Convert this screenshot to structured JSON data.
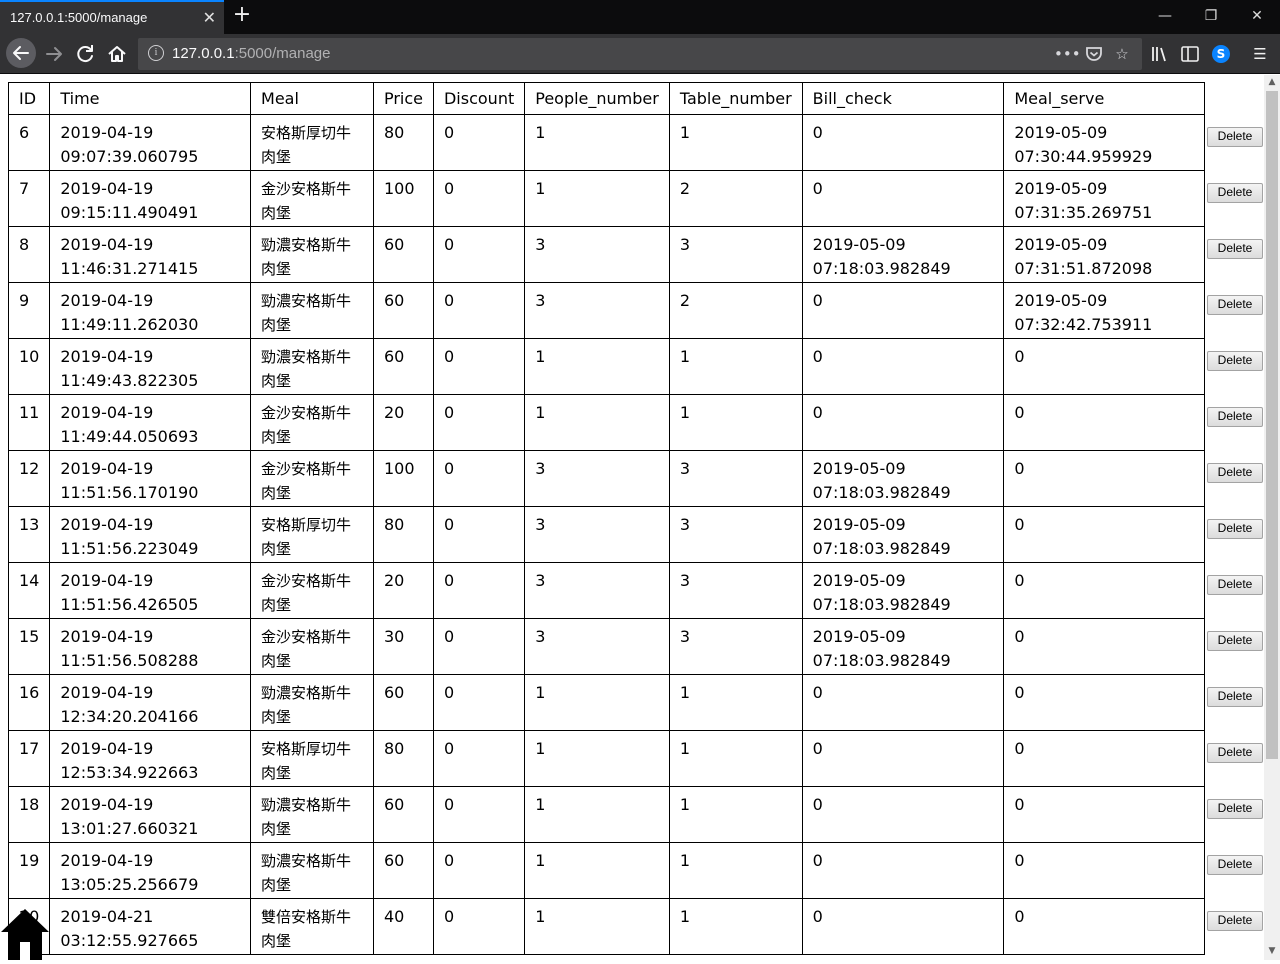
{
  "browser": {
    "tab_title": "127.0.0.1:5000/manage",
    "tab_close": "✕",
    "new_tab": "+",
    "url_host": "127.0.0.1",
    "url_rest": ":5000/manage",
    "minimize": "—",
    "restore": "❐",
    "close": "✕"
  },
  "table": {
    "headers": [
      "ID",
      "Time",
      "Meal",
      "Price",
      "Discount",
      "People_number",
      "Table_number",
      "Bill_check",
      "Meal_serve"
    ],
    "delete_label": "Delete",
    "rows": [
      {
        "id": "6",
        "time1": "2019-04-19",
        "time2": "09:07:39.060795",
        "meal": "安格斯厚切牛肉堡",
        "price": "80",
        "discount": "0",
        "people": "1",
        "table": "1",
        "bill1": "0",
        "bill2": "",
        "serve1": "2019-05-09",
        "serve2": "07:30:44.959929"
      },
      {
        "id": "7",
        "time1": "2019-04-19",
        "time2": "09:15:11.490491",
        "meal": "金沙安格斯牛肉堡",
        "price": "100",
        "discount": "0",
        "people": "1",
        "table": "2",
        "bill1": "0",
        "bill2": "",
        "serve1": "2019-05-09",
        "serve2": "07:31:35.269751"
      },
      {
        "id": "8",
        "time1": "2019-04-19",
        "time2": "11:46:31.271415",
        "meal": "勁濃安格斯牛肉堡",
        "price": "60",
        "discount": "0",
        "people": "3",
        "table": "3",
        "bill1": "2019-05-09",
        "bill2": "07:18:03.982849",
        "serve1": "2019-05-09",
        "serve2": "07:31:51.872098"
      },
      {
        "id": "9",
        "time1": "2019-04-19",
        "time2": "11:49:11.262030",
        "meal": "勁濃安格斯牛肉堡",
        "price": "60",
        "discount": "0",
        "people": "3",
        "table": "2",
        "bill1": "0",
        "bill2": "",
        "serve1": "2019-05-09",
        "serve2": "07:32:42.753911"
      },
      {
        "id": "10",
        "time1": "2019-04-19",
        "time2": "11:49:43.822305",
        "meal": "勁濃安格斯牛肉堡",
        "price": "60",
        "discount": "0",
        "people": "1",
        "table": "1",
        "bill1": "0",
        "bill2": "",
        "serve1": "0",
        "serve2": ""
      },
      {
        "id": "11",
        "time1": "2019-04-19",
        "time2": "11:49:44.050693",
        "meal": "金沙安格斯牛肉堡",
        "price": "20",
        "discount": "0",
        "people": "1",
        "table": "1",
        "bill1": "0",
        "bill2": "",
        "serve1": "0",
        "serve2": ""
      },
      {
        "id": "12",
        "time1": "2019-04-19",
        "time2": "11:51:56.170190",
        "meal": "金沙安格斯牛肉堡",
        "price": "100",
        "discount": "0",
        "people": "3",
        "table": "3",
        "bill1": "2019-05-09",
        "bill2": "07:18:03.982849",
        "serve1": "0",
        "serve2": ""
      },
      {
        "id": "13",
        "time1": "2019-04-19",
        "time2": "11:51:56.223049",
        "meal": "安格斯厚切牛肉堡",
        "price": "80",
        "discount": "0",
        "people": "3",
        "table": "3",
        "bill1": "2019-05-09",
        "bill2": "07:18:03.982849",
        "serve1": "0",
        "serve2": ""
      },
      {
        "id": "14",
        "time1": "2019-04-19",
        "time2": "11:51:56.426505",
        "meal": "金沙安格斯牛肉堡",
        "price": "20",
        "discount": "0",
        "people": "3",
        "table": "3",
        "bill1": "2019-05-09",
        "bill2": "07:18:03.982849",
        "serve1": "0",
        "serve2": ""
      },
      {
        "id": "15",
        "time1": "2019-04-19",
        "time2": "11:51:56.508288",
        "meal": "金沙安格斯牛肉堡",
        "price": "30",
        "discount": "0",
        "people": "3",
        "table": "3",
        "bill1": "2019-05-09",
        "bill2": "07:18:03.982849",
        "serve1": "0",
        "serve2": ""
      },
      {
        "id": "16",
        "time1": "2019-04-19",
        "time2": "12:34:20.204166",
        "meal": "勁濃安格斯牛肉堡",
        "price": "60",
        "discount": "0",
        "people": "1",
        "table": "1",
        "bill1": "0",
        "bill2": "",
        "serve1": "0",
        "serve2": ""
      },
      {
        "id": "17",
        "time1": "2019-04-19",
        "time2": "12:53:34.922663",
        "meal": "安格斯厚切牛肉堡",
        "price": "80",
        "discount": "0",
        "people": "1",
        "table": "1",
        "bill1": "0",
        "bill2": "",
        "serve1": "0",
        "serve2": ""
      },
      {
        "id": "18",
        "time1": "2019-04-19",
        "time2": "13:01:27.660321",
        "meal": "勁濃安格斯牛肉堡",
        "price": "60",
        "discount": "0",
        "people": "1",
        "table": "1",
        "bill1": "0",
        "bill2": "",
        "serve1": "0",
        "serve2": ""
      },
      {
        "id": "19",
        "time1": "2019-04-19",
        "time2": "13:05:25.256679",
        "meal": "勁濃安格斯牛肉堡",
        "price": "60",
        "discount": "0",
        "people": "1",
        "table": "1",
        "bill1": "0",
        "bill2": "",
        "serve1": "0",
        "serve2": ""
      },
      {
        "id": "20",
        "time1": "2019-04-21",
        "time2": "03:12:55.927665",
        "meal": "雙倍安格斯牛肉堡",
        "price": "40",
        "discount": "0",
        "people": "1",
        "table": "1",
        "bill1": "0",
        "bill2": "",
        "serve1": "0",
        "serve2": ""
      }
    ]
  }
}
